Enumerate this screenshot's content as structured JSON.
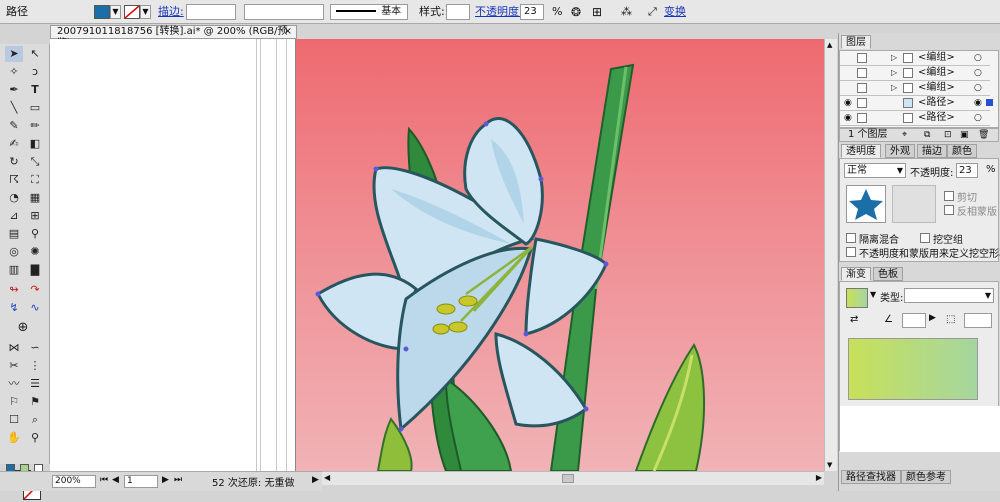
{
  "control_bar": {
    "object_type": "路径",
    "stroke_label": "描边:",
    "stroke_style": "基本",
    "style_label": "样式:",
    "opacity_label": "不透明度:",
    "opacity_value": "23",
    "opacity_unit": "%",
    "transform_label": "变换"
  },
  "document": {
    "tab_title": "20079101181875​6 [转换].ai* @ 200% (RGB/预览)",
    "close_glyph": "×"
  },
  "status_bar": {
    "zoom": "200%",
    "page": "1",
    "history": "52 次还原: 无重做"
  },
  "layers_panel": {
    "tab": "图层",
    "rows": [
      {
        "label": "<编组>"
      },
      {
        "label": "<编组>"
      },
      {
        "label": "<编组>"
      },
      {
        "label": "<路径>"
      },
      {
        "label": "<路径>"
      }
    ],
    "count": "1 个图层"
  },
  "transparency_panel": {
    "tabs": [
      "透明度",
      "外观",
      "描边",
      "颜色"
    ],
    "blend_mode": "正常",
    "opacity_label": "不透明度:",
    "opacity_value": "23",
    "opacity_unit": "%",
    "clip_label": "剪切",
    "invert_mask_label": "反相蒙版",
    "isolate_label": "隔离混合",
    "knockout_label": "挖空组",
    "opacity_mask_label": "不透明度和蒙版用来定义挖空形状"
  },
  "gradient_panel": {
    "tabs": [
      "渐变",
      "色板"
    ],
    "type_label": "类型:"
  },
  "bottom_panel": {
    "tabs": [
      "路径查找器",
      "颜色参考"
    ]
  },
  "colors": {
    "fill": "#1b6fa8",
    "artboard_top": "#ee6a70",
    "gradient_start": "#c8e05a",
    "gradient_end": "#a5d6a0",
    "petal": "#cfe5f4",
    "stem": "#3b9a4a"
  }
}
